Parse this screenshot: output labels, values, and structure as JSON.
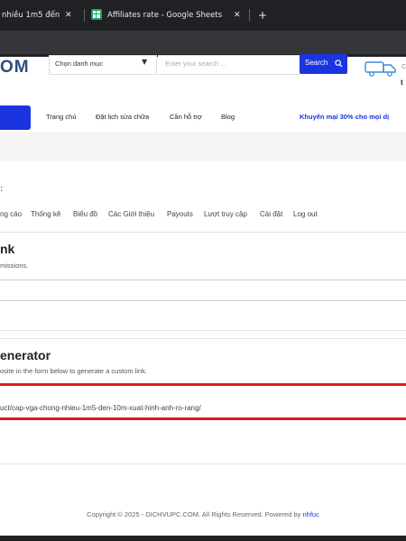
{
  "browser": {
    "tabs": [
      {
        "title": "nhiều 1m5 đến",
        "close": "✕"
      },
      {
        "title": "Affiliates rate - Google Sheets",
        "close": "✕"
      }
    ],
    "new_tab": "+"
  },
  "header": {
    "logo": "OM",
    "category_label": "Chọn danh mục",
    "search_placeholder": "Enter your search ...",
    "search_button": "Search",
    "truck_text": "t",
    "truck_small": "C"
  },
  "nav": {
    "items": [
      "Trang chủ",
      "Đặt lịch sửa chữa",
      "Cần hỗ trợ",
      "Blog"
    ],
    "promo": "Khuyến mại 30% cho mọi dị"
  },
  "affiliate": {
    "colon": ":",
    "menu": [
      "ng cáo",
      "Thống kê",
      "Biểu đồ",
      "Các Giới thiệu",
      "Payouts",
      "Lượt truy cập",
      "Cài đặt",
      "Log out"
    ],
    "link_section": {
      "title": "nk",
      "desc": "missions."
    },
    "generator_section": {
      "title": "enerator",
      "desc": "osite in the form below to generate a custom link.",
      "value": "uct/cap-vga-chong-nhieu-1m5-den-10m-xuat-hinh-anh-ro-rang/"
    }
  },
  "footer": {
    "text": "Copyright © 2025 - DICHVUPC.COM. All Rights Reserved. Powered by ",
    "link": "nhfuc"
  },
  "colors": {
    "accent": "#1a35e0",
    "highlight": "#e21a1a",
    "chrome": "#202124",
    "sheets_green": "#1fa463"
  }
}
